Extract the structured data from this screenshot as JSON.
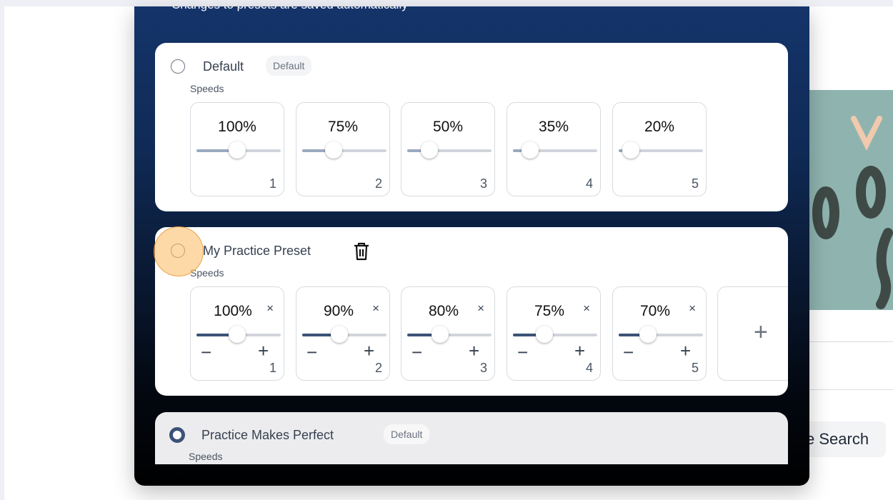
{
  "dialog": {
    "subtitle": "Changes to presets are saved automatically"
  },
  "presets": [
    {
      "name": "Default",
      "badge": "Default",
      "speeds_label": "Speeds",
      "selected": false,
      "deletable": false,
      "speeds": [
        {
          "label": "100%",
          "index": "1",
          "slider_fraction": 0.48
        },
        {
          "label": "75%",
          "index": "2",
          "slider_fraction": 0.37
        },
        {
          "label": "50%",
          "index": "3",
          "slider_fraction": 0.26
        },
        {
          "label": "35%",
          "index": "4",
          "slider_fraction": 0.2
        },
        {
          "label": "20%",
          "index": "5",
          "slider_fraction": 0.14
        }
      ]
    },
    {
      "name": "My Practice Preset",
      "badge": "",
      "speeds_label": "Speeds",
      "selected": false,
      "deletable": true,
      "speeds": [
        {
          "label": "100%",
          "index": "1",
          "slider_fraction": 0.48
        },
        {
          "label": "90%",
          "index": "2",
          "slider_fraction": 0.44
        },
        {
          "label": "80%",
          "index": "3",
          "slider_fraction": 0.39
        },
        {
          "label": "75%",
          "index": "4",
          "slider_fraction": 0.37
        },
        {
          "label": "70%",
          "index": "5",
          "slider_fraction": 0.35
        }
      ],
      "remove_symbol": "×",
      "decrement_symbol": "−",
      "increment_symbol": "+",
      "add_symbol": "+"
    },
    {
      "name": "Practice Makes Perfect",
      "badge": "Default",
      "speeds_label": "Speeds",
      "selected": true
    }
  ],
  "background": {
    "search_button_label": "e Search"
  },
  "icons": {
    "delete": "trash-icon",
    "remove": "close-icon",
    "decrement": "minus-icon",
    "increment": "plus-icon",
    "add": "plus-icon"
  },
  "colors": {
    "dialog_top": "#14346a",
    "dialog_bottom": "#000000",
    "slider_accent": "#3c5277",
    "slider_muted": "#9aaabf",
    "cursor_highlight": "#fbbf6c"
  }
}
